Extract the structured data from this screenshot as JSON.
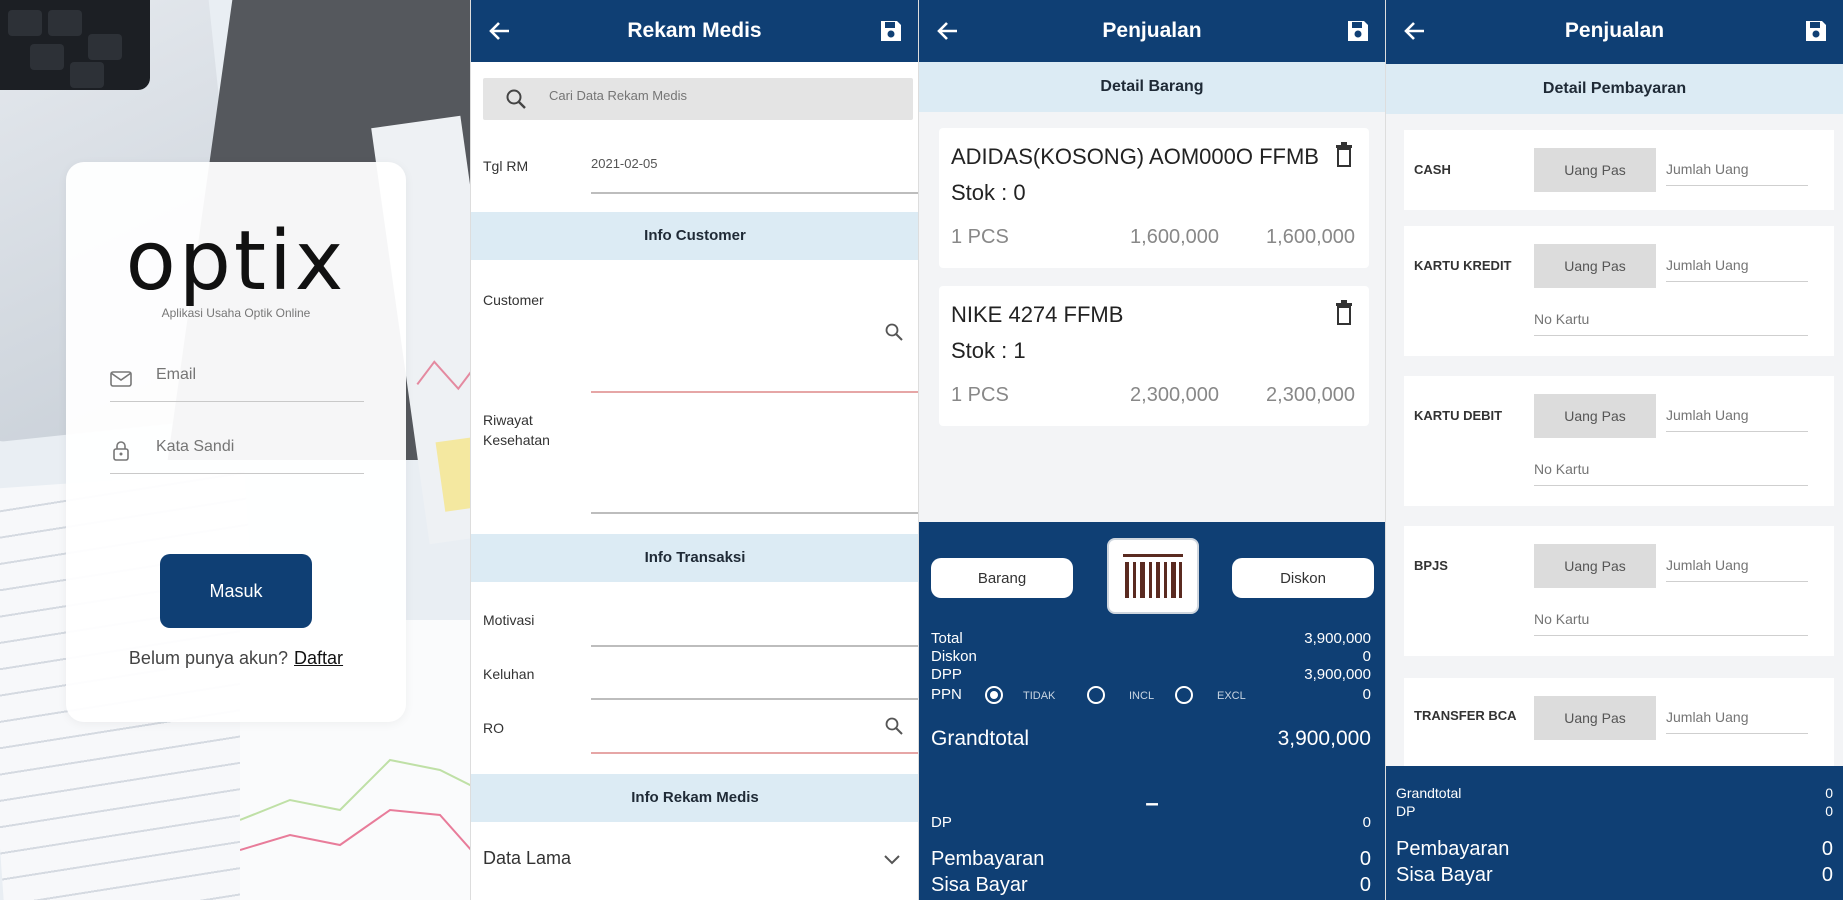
{
  "login": {
    "logo_text": "optix",
    "tagline": "Aplikasi Usaha Optik Online",
    "email_placeholder": "Email",
    "password_placeholder": "Kata Sandi",
    "submit_label": "Masuk",
    "register_prompt": "Belum punya akun?",
    "register_link": "Daftar"
  },
  "rekam_medis": {
    "title": "Rekam Medis",
    "search_placeholder": "Cari Data Rekam Medis",
    "tgl_label": "Tgl RM",
    "tgl_value": "2021-02-05",
    "section_customer": "Info Customer",
    "customer_label": "Customer",
    "riwayat_label_1": "Riwayat",
    "riwayat_label_2": "Kesehatan",
    "section_transaksi": "Info Transaksi",
    "motivasi_label": "Motivasi",
    "keluhan_label": "Keluhan",
    "ro_label": "RO",
    "section_rekam": "Info Rekam Medis",
    "data_lama_label": "Data Lama"
  },
  "penjualan_items": {
    "title": "Penjualan",
    "subheader": "Detail Barang",
    "items": [
      {
        "name": "ADIDAS(KOSONG) AOM000O FFMB",
        "stok": "Stok : 0",
        "qty": "1 PCS",
        "price": "1,600,000",
        "total": "1,600,000"
      },
      {
        "name": "NIKE 4274 FFMB",
        "stok": "Stok : 1",
        "qty": "1 PCS",
        "price": "2,300,000",
        "total": "2,300,000"
      }
    ],
    "barang_button": "Barang",
    "diskon_button": "Diskon",
    "total_label": "Total",
    "total_value": "3,900,000",
    "diskon_label": "Diskon",
    "diskon_value": "0",
    "dpp_label": "DPP",
    "dpp_value": "3,900,000",
    "ppn_label": "PPN",
    "ppn_value": "0",
    "ppn_options": [
      "TIDAK",
      "INCL",
      "EXCL"
    ],
    "ppn_selected": "TIDAK",
    "grandtotal_label": "Grandtotal",
    "grandtotal_value": "3,900,000",
    "dash": "–",
    "dp_label": "DP",
    "dp_value": "0",
    "pembayaran_label": "Pembayaran",
    "pembayaran_value": "0",
    "sisa_label": "Sisa Bayar",
    "sisa_value": "0"
  },
  "penjualan_bayar": {
    "title": "Penjualan",
    "subheader": "Detail Pembayaran",
    "uang_pas_label": "Uang Pas",
    "jumlah_placeholder": "Jumlah Uang",
    "no_kartu_placeholder": "No Kartu",
    "methods": [
      "CASH",
      "KARTU KREDIT",
      "KARTU DEBIT",
      "BPJS",
      "TRANSFER BCA"
    ],
    "grandtotal_label": "Grandtotal",
    "grandtotal_value": "0",
    "dp_label": "DP",
    "dp_value": "0",
    "pembayaran_label": "Pembayaran",
    "pembayaran_value": "0",
    "sisa_label": "Sisa Bayar",
    "sisa_value": "0"
  },
  "colors": {
    "primary": "#0f3f74",
    "section": "#dcebf4"
  }
}
